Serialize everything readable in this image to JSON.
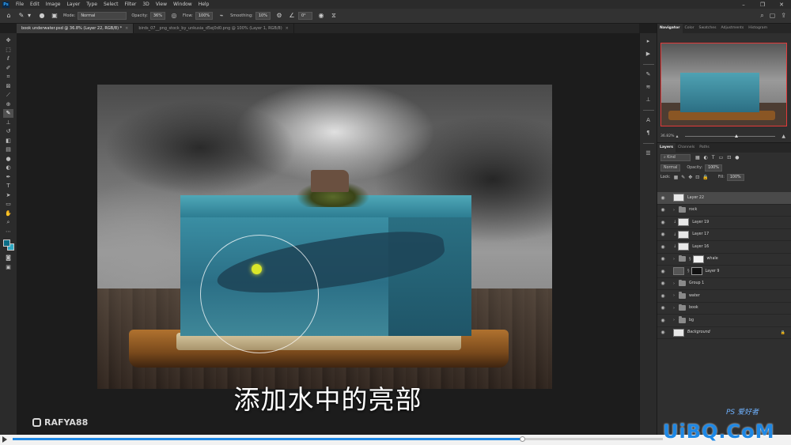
{
  "menubar": {
    "logo": "Ps",
    "items": [
      "File",
      "Edit",
      "Image",
      "Layer",
      "Type",
      "Select",
      "Filter",
      "3D",
      "View",
      "Window",
      "Help"
    ],
    "window_controls": [
      "–",
      "❐",
      "✕"
    ]
  },
  "options": {
    "mode_label": "Mode:",
    "mode_value": "Normal",
    "opacity_label": "Opacity:",
    "opacity_value": "36%",
    "flow_label": "Flow:",
    "flow_value": "100%",
    "smoothing_label": "Smoothing:",
    "smoothing_value": "10%",
    "angle_value": "0°"
  },
  "tabs": [
    {
      "label": "book underwater.psd @ 36.8% (Layer 22, RGB/8) *",
      "active": true
    },
    {
      "label": "birds_07__png_stock_by_unkusia_d5ej0d0.png @ 100% (Layer 1, RGB/8)",
      "active": false
    }
  ],
  "toolbar": {
    "tools": [
      "move-tool",
      "marquee-tool",
      "lasso-tool",
      "quick-select-tool",
      "crop-tool",
      "frame-tool",
      "eyedropper-tool",
      "healing-tool",
      "brush-tool",
      "clone-stamp-tool",
      "history-brush-tool",
      "eraser-tool",
      "gradient-tool",
      "blur-tool",
      "dodge-tool",
      "pen-tool",
      "type-tool",
      "path-select-tool",
      "shape-tool",
      "hand-tool",
      "zoom-tool"
    ],
    "active_tool": "brush-tool",
    "foreground_color": "#0a6d86",
    "background_color": "#2fa8c2"
  },
  "navigator": {
    "tabs": [
      "Navigator",
      "Color",
      "Swatches",
      "Adjustments",
      "Histogram"
    ],
    "active_tab": "Navigator",
    "zoom": "36.82%"
  },
  "layers_panel": {
    "tabs": [
      "Layers",
      "Channels",
      "Paths"
    ],
    "active_tab": "Layers",
    "filter_kind": "Kind",
    "blend_mode": "Normal",
    "opacity_label": "Opacity:",
    "opacity_value": "100%",
    "lock_label": "Lock:",
    "fill_label": "Fill:",
    "fill_value": "100%",
    "layers": [
      {
        "name": "Layer 22",
        "type": "layer",
        "selected": true,
        "thumb": "light"
      },
      {
        "name": "rock",
        "type": "group"
      },
      {
        "name": "Layer 19",
        "type": "layer",
        "thumb": "light",
        "clipped": true
      },
      {
        "name": "Layer 17",
        "type": "layer",
        "thumb": "light",
        "clipped": true
      },
      {
        "name": "Layer 16",
        "type": "layer",
        "thumb": "light",
        "clipped": true
      },
      {
        "name": "whale",
        "type": "group",
        "mask": "white"
      },
      {
        "name": "Layer 9",
        "type": "layer",
        "thumb": "dark",
        "mask": "black"
      },
      {
        "name": "Group 1",
        "type": "group"
      },
      {
        "name": "water",
        "type": "group"
      },
      {
        "name": "book",
        "type": "group"
      },
      {
        "name": "bg",
        "type": "group"
      },
      {
        "name": "Background",
        "type": "background",
        "thumb": "light",
        "locked": true
      }
    ]
  },
  "subtitle": "添加水中的亮部",
  "watermarks": {
    "channel": "RAFYA88",
    "site": "UiBQ.CoM",
    "ps_mark": "PS 爱好者"
  },
  "video": {
    "progress": 0.7846
  }
}
